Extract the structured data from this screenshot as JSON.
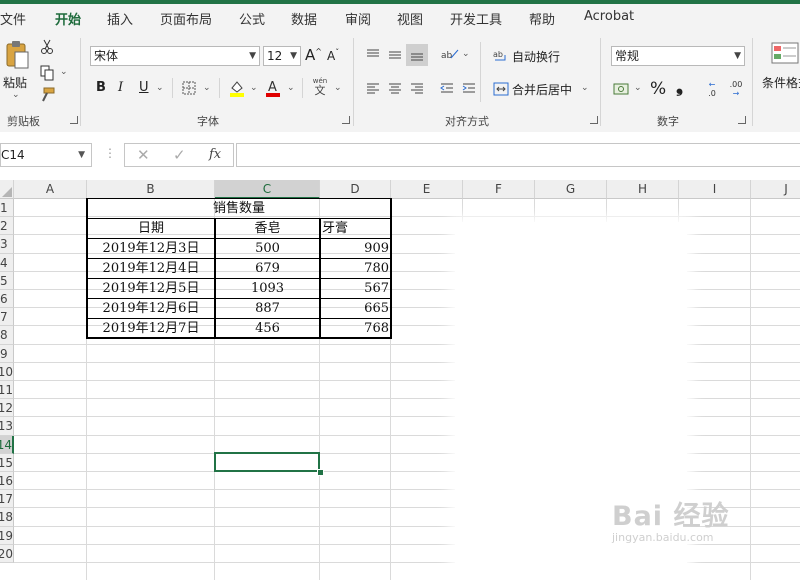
{
  "menu": {
    "tabs": [
      "文件",
      "开始",
      "插入",
      "页面布局",
      "公式",
      "数据",
      "审阅",
      "视图",
      "开发工具",
      "帮助",
      "Acrobat"
    ],
    "active": "开始"
  },
  "ribbon": {
    "clipboard": {
      "label": "剪贴板",
      "paste": "粘贴"
    },
    "font": {
      "label": "字体",
      "name": "宋体",
      "size": "12",
      "bold": "B",
      "italic": "I",
      "underline": "U",
      "grow": "A",
      "shrink": "A",
      "phonetic_top": "wén",
      "phonetic_bottom": "文"
    },
    "alignment": {
      "label": "对齐方式",
      "wrap_text": "自动换行",
      "merge_center": "合并后居中"
    },
    "number": {
      "label": "数字",
      "format": "常规",
      "percent": "%",
      "comma": "❟",
      "inc_decimal": ".0",
      "dec_decimal": ".00"
    },
    "styles": {
      "cond_format": "条件格式"
    }
  },
  "formula_bar": {
    "name_box": "C14",
    "fx": "fx",
    "value": ""
  },
  "sheet": {
    "columns": [
      "A",
      "B",
      "C",
      "D",
      "E",
      "F",
      "G",
      "H",
      "I",
      "J"
    ],
    "selected_column": "C",
    "selected_row": "14",
    "rows": [
      "1",
      "2",
      "3",
      "4",
      "5",
      "6",
      "7",
      "8",
      "9",
      "10",
      "11",
      "12",
      "13",
      "14",
      "15",
      "16",
      "17",
      "18",
      "19",
      "20"
    ],
    "table": {
      "title": "销售数量",
      "headers": [
        "日期",
        "香皂",
        "牙膏"
      ],
      "data": [
        [
          "2019年12月3日",
          "500",
          "909"
        ],
        [
          "2019年12月4日",
          "679",
          "780"
        ],
        [
          "2019年12月5日",
          "1093",
          "567"
        ],
        [
          "2019年12月6日",
          "887",
          "665"
        ],
        [
          "2019年12月7日",
          "456",
          "768"
        ]
      ]
    }
  },
  "watermark": {
    "main": "Bai 经验",
    "sub": "jingyan.baidu.com"
  },
  "colors": {
    "accent": "#217346",
    "ribbon_bg": "#f3f3f3",
    "header_bg": "#efefef",
    "font_color_red": "#e00000",
    "highlight_yellow": "#ffff00"
  }
}
